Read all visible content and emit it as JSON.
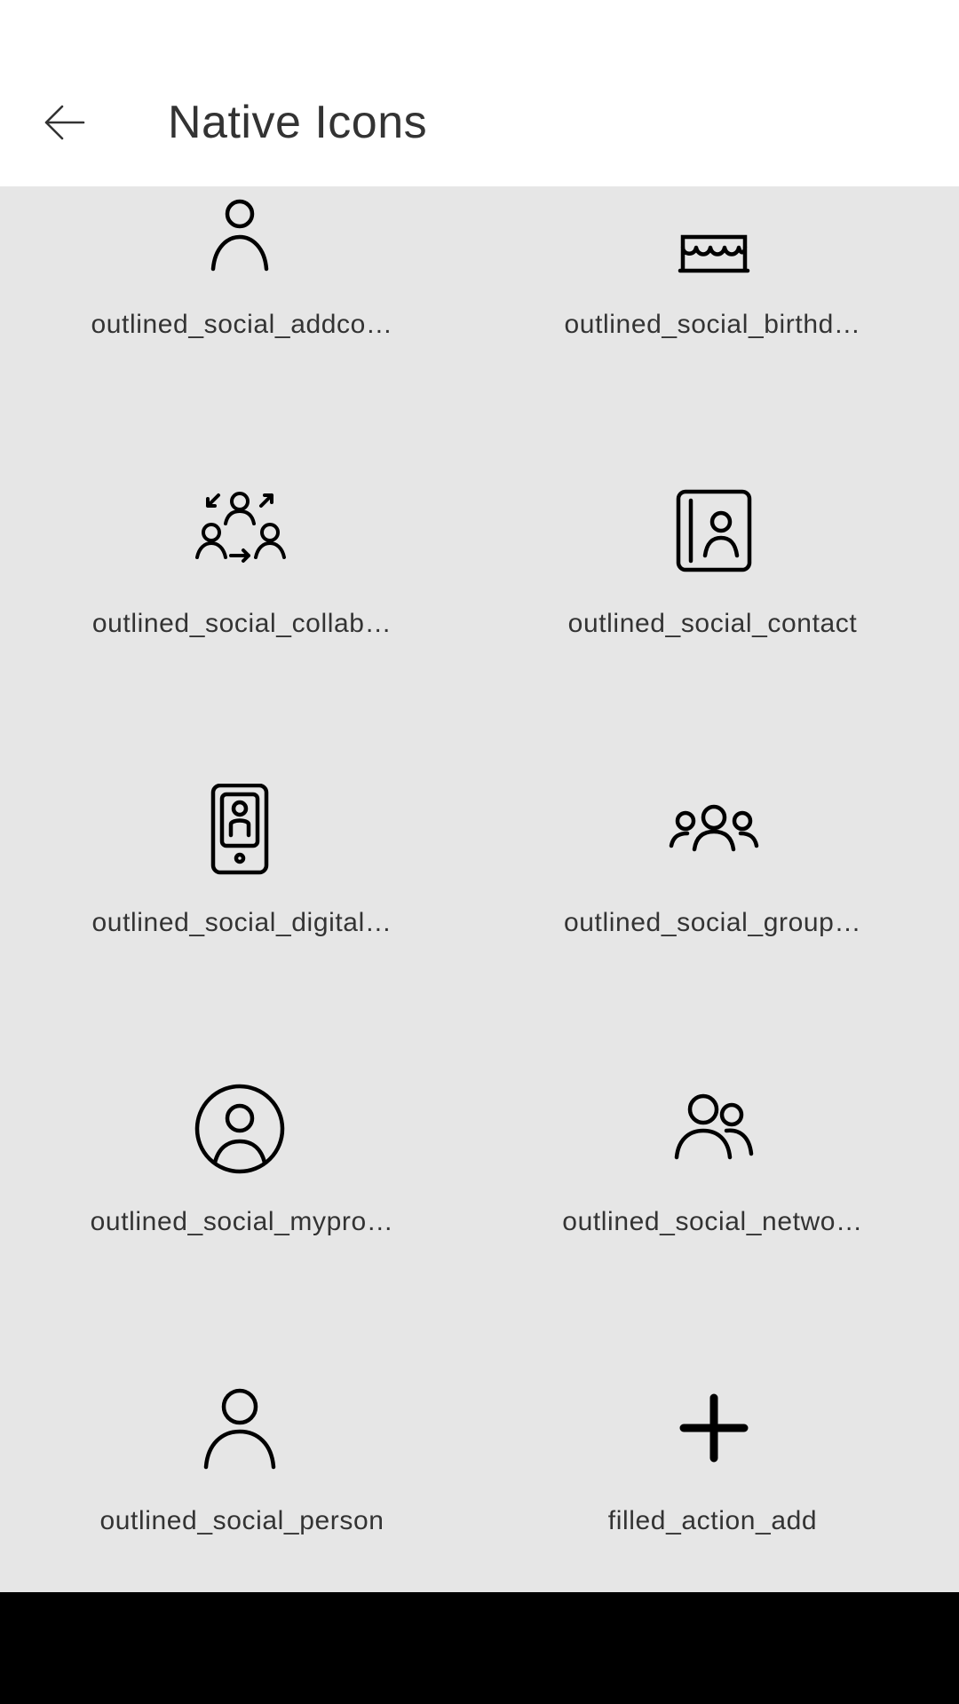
{
  "app_bar": {
    "title": "Native Icons",
    "back_icon": "arrow-left-icon"
  },
  "icons": [
    {
      "label": "outlined_social_addco…",
      "icon": "add-contact-icon"
    },
    {
      "label": "outlined_social_birthd…",
      "icon": "birthday-cake-icon"
    },
    {
      "label": "outlined_social_collab…",
      "icon": "collaboration-icon"
    },
    {
      "label": "outlined_social_contact",
      "icon": "contact-book-icon"
    },
    {
      "label": "outlined_social_digital…",
      "icon": "digital-id-phone-icon"
    },
    {
      "label": "outlined_social_group…",
      "icon": "group-icon"
    },
    {
      "label": "outlined_social_mypro…",
      "icon": "my-profile-icon"
    },
    {
      "label": "outlined_social_netwo…",
      "icon": "network-icon"
    },
    {
      "label": "outlined_social_person",
      "icon": "person-icon"
    },
    {
      "label": "filled_action_add",
      "icon": "plus-icon"
    }
  ],
  "colors": {
    "background": "#e6e6e6",
    "app_bar": "#ffffff",
    "text": "#333333",
    "icon": "#000000",
    "nav_bar": "#000000"
  }
}
